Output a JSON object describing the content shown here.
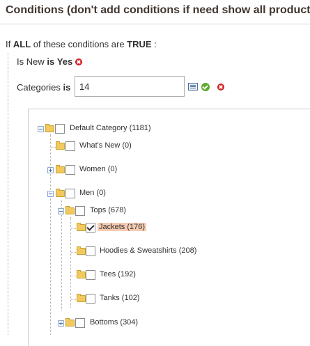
{
  "header": {
    "title": "Conditions (don't add conditions if need show all products)"
  },
  "rule": {
    "prefix": "If",
    "aggregator": "ALL",
    "middle": "of these conditions are",
    "value": "TRUE",
    "suffix": ":"
  },
  "cond_new": {
    "attribute": "Is New",
    "operator": "is",
    "value": "Yes"
  },
  "cond_cat": {
    "attribute": "Categories",
    "operator": "is",
    "value": "14"
  },
  "tree": [
    {
      "label": "Default Category (1181)",
      "checked": false
    },
    {
      "label": "What's New (0)",
      "checked": false
    },
    {
      "label": "Women (0)",
      "checked": false
    },
    {
      "label": "Men (0)",
      "checked": false
    },
    {
      "label": "Tops (678)",
      "checked": false
    },
    {
      "label": "Jackets (176)",
      "checked": true,
      "selected": true
    },
    {
      "label": "Hoodies & Sweatshirts (208)",
      "checked": false
    },
    {
      "label": "Tees (192)",
      "checked": false
    },
    {
      "label": "Tanks (102)",
      "checked": false
    },
    {
      "label": "Bottoms (304)",
      "checked": false
    }
  ],
  "icons": {
    "remove": "remove-icon",
    "apply": "apply-icon",
    "chooser": "chooser-icon",
    "folder": "folder-icon",
    "expander": "expander-icon"
  },
  "colors": {
    "remove": "#e22626",
    "apply": "#5fa92d",
    "selected_bg": "#f6cbb2",
    "folder": "#f1c95c"
  }
}
